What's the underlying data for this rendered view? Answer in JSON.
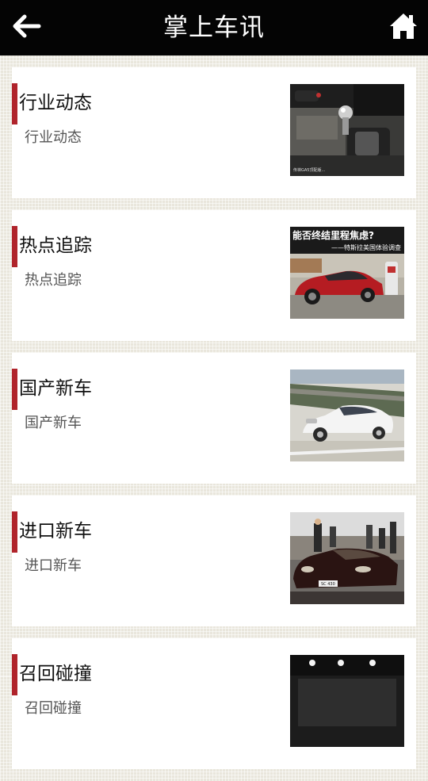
{
  "header": {
    "title": "掌上车讯",
    "back_icon": "arrow-left-icon",
    "home_icon": "house-icon"
  },
  "colors": {
    "header_bg": "#040404",
    "accent": "#b0242b",
    "card_bg": "#ffffff",
    "page_bg": "#e9e6dc"
  },
  "categories": [
    {
      "title": "行业动态",
      "subtitle": "行业动态",
      "image": "car-gear-shift-photo",
      "caption": "传祺GA5顶配版..."
    },
    {
      "title": "热点追踪",
      "subtitle": "热点追踪",
      "image": "red-tesla-charging-photo",
      "caption": "能否终结里程焦虑?",
      "caption2": "——特斯拉美国体验调查"
    },
    {
      "title": "国产新车",
      "subtitle": "国产新车",
      "image": "white-sedan-track-photo"
    },
    {
      "title": "进口新车",
      "subtitle": "进口新车",
      "image": "black-convertible-showroom-photo",
      "plate": "SC 430"
    },
    {
      "title": "召回碰撞",
      "subtitle": "召回碰撞",
      "image": "dark-garage-lights-photo"
    }
  ]
}
